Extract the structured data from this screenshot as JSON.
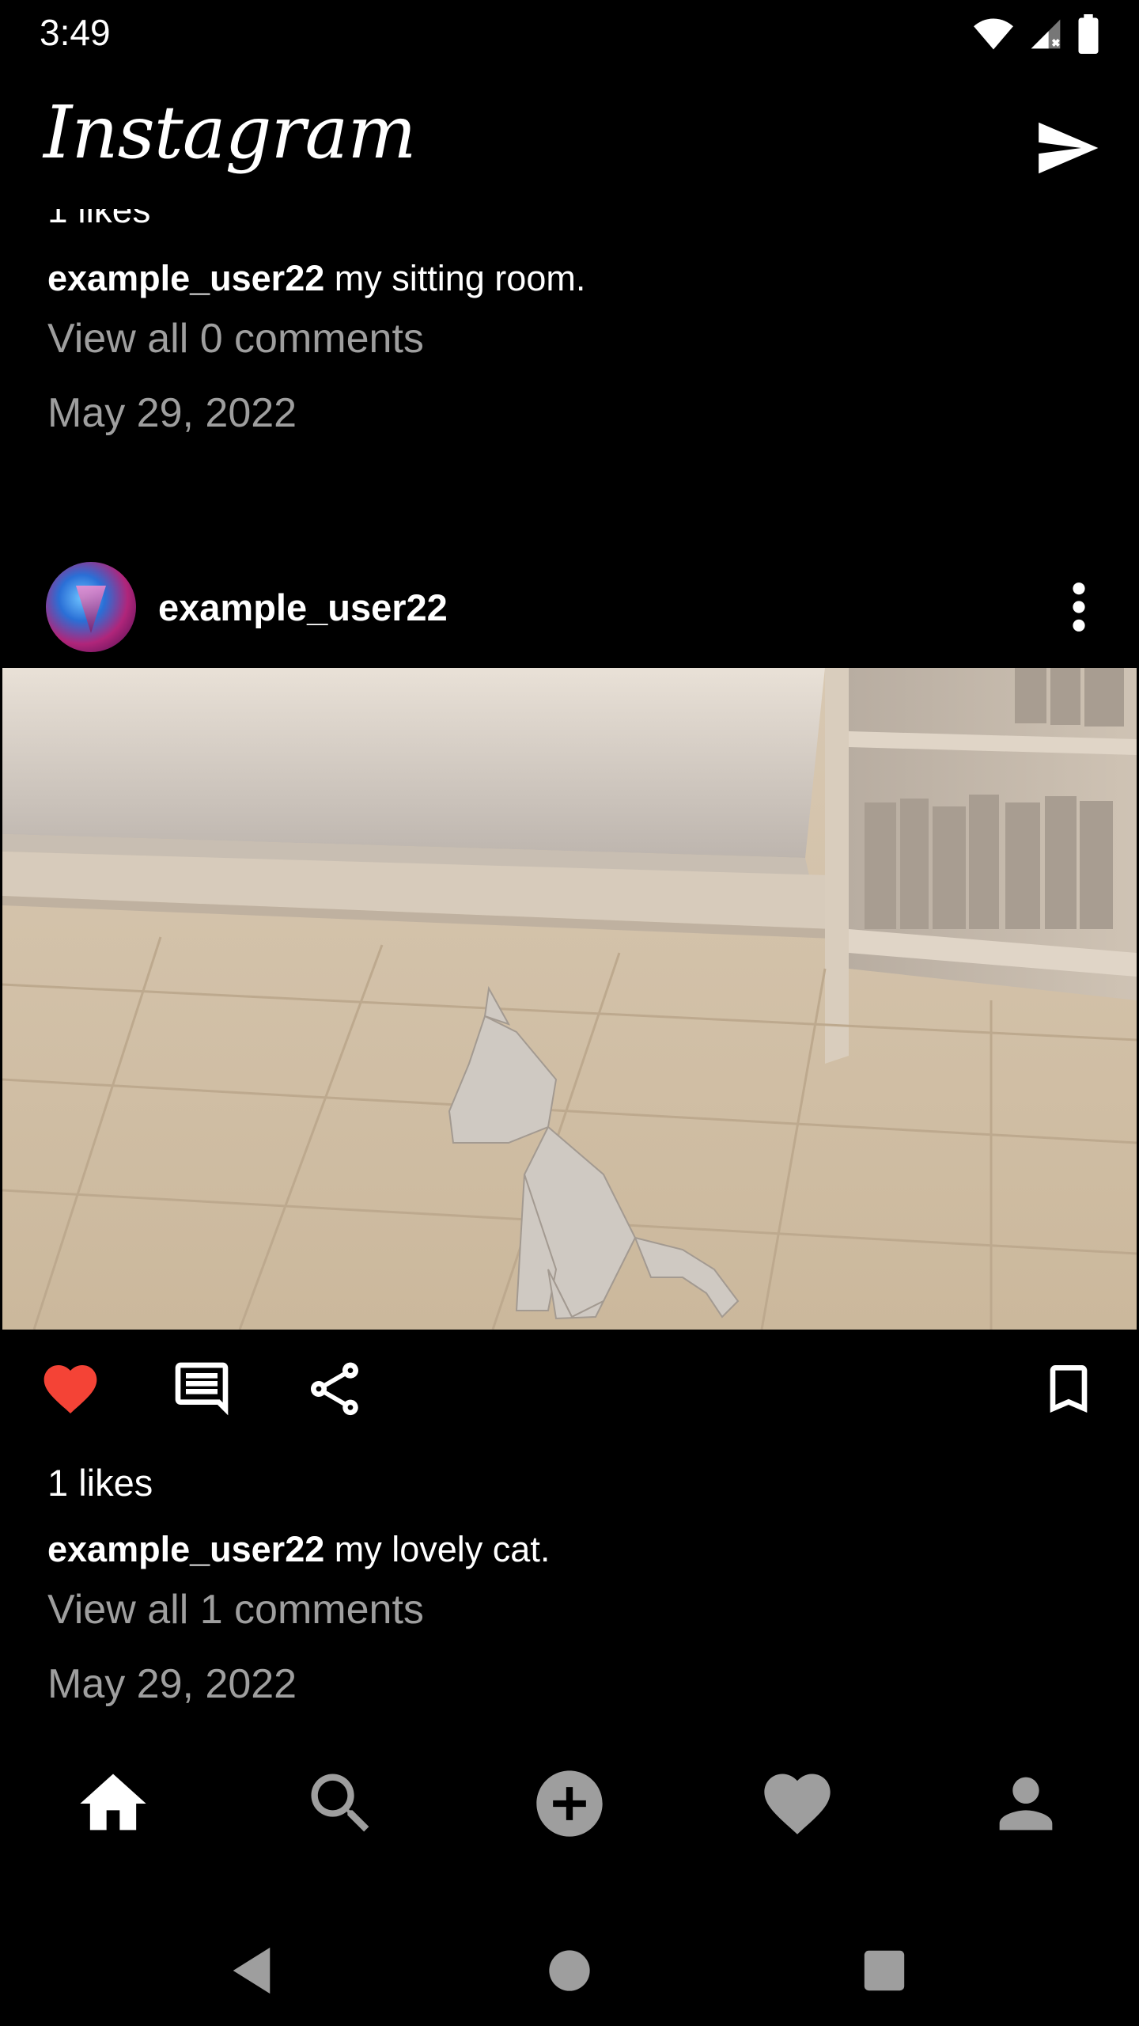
{
  "status_bar": {
    "time": "3:49"
  },
  "app_bar": {
    "logo": "Instagram"
  },
  "previous_post": {
    "likes_cut": "1 likes",
    "username": "example_user22",
    "caption": "my sitting room.",
    "view_comments": "View all 0 comments",
    "date": "May 29, 2022"
  },
  "post": {
    "username": "example_user22",
    "likes": "1 likes",
    "caption_user": "example_user22",
    "caption": "my lovely cat.",
    "view_comments": "View all 1 comments",
    "date": "May 29, 2022",
    "liked": true
  },
  "icons": {
    "like": "heart-icon",
    "comment": "comment-icon",
    "share": "share-icon",
    "bookmark": "bookmark-icon",
    "more": "more-vert-icon",
    "direct": "send-icon"
  },
  "bottom_nav": [
    "home-icon",
    "search-icon",
    "add-icon",
    "heart-icon",
    "profile-icon"
  ],
  "colors": {
    "like": "#f44336",
    "muted_text": "#9e9e9e",
    "background": "#000000"
  }
}
